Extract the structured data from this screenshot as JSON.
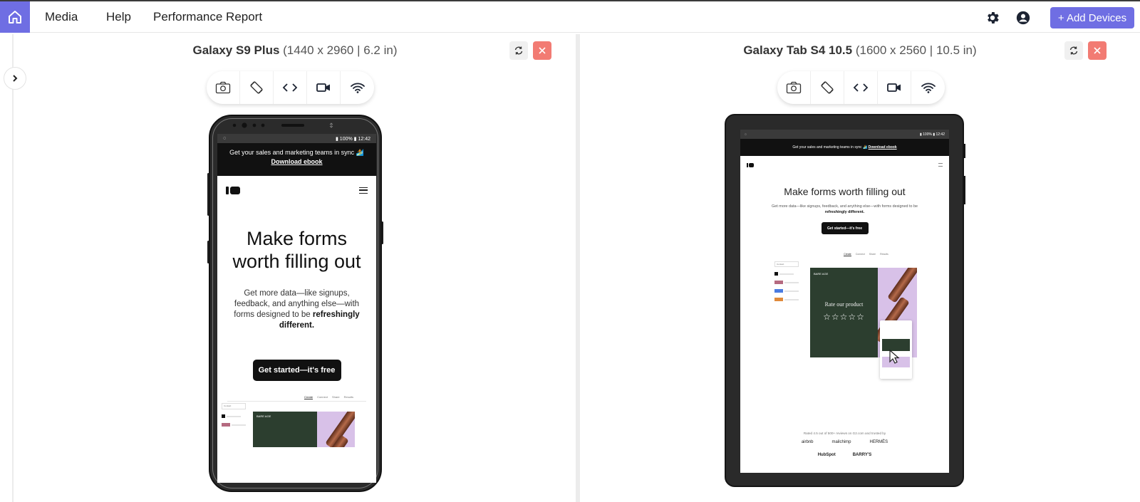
{
  "nav": {
    "items": [
      "Media",
      "Help",
      "Performance Report"
    ],
    "add_devices": "+ Add Devices"
  },
  "colors": {
    "accent": "#6f6ee3",
    "close": "#f27b73"
  },
  "devices": [
    {
      "name": "Galaxy S9 Plus",
      "spec": "(1440 x 2960 | 6.2 in)",
      "screen": {
        "time": "12:42",
        "battery": "100%",
        "promo": "Get your sales and marketing teams in sync 🏄",
        "promo_link": "Download ebook",
        "title": "Make forms worth filling out",
        "sub_pre": "Get more data—like signups, feedback, and anything else—with forms designed to be ",
        "sub_bold": "refreshingly different.",
        "cta": "Get started—it's free",
        "tabs": [
          "Create",
          "Connect",
          "Share",
          "Results"
        ],
        "select": "Contact",
        "brand": "BARE AGE"
      }
    },
    {
      "name": "Galaxy Tab S4 10.5",
      "spec": "(1600 x 2560 | 10.5 in)",
      "screen": {
        "time": "12:42",
        "battery": "100%",
        "promo": "Get your sales and marketing teams in sync 🏄",
        "promo_link": "Download ebook",
        "title": "Make forms worth filling out",
        "sub_pre": "Get more data—like signups, feedback, and anything else—with forms designed to be ",
        "sub_bold": "refreshingly different.",
        "cta": "Get started—it's free",
        "tabs": [
          "Create",
          "Connect",
          "Share",
          "Results"
        ],
        "select": "Contact",
        "brand": "BARE AGE",
        "rate": "Rate our product",
        "stars": "☆☆☆☆☆",
        "rated": "Rated 4.5 out of 500+ reviews on G2.com and trusted by",
        "logos_row1": [
          "airbnb",
          "mailchimp",
          "HERMÈS"
        ],
        "logos_row2": [
          "HubSpot",
          "BARRY'S"
        ]
      }
    }
  ]
}
